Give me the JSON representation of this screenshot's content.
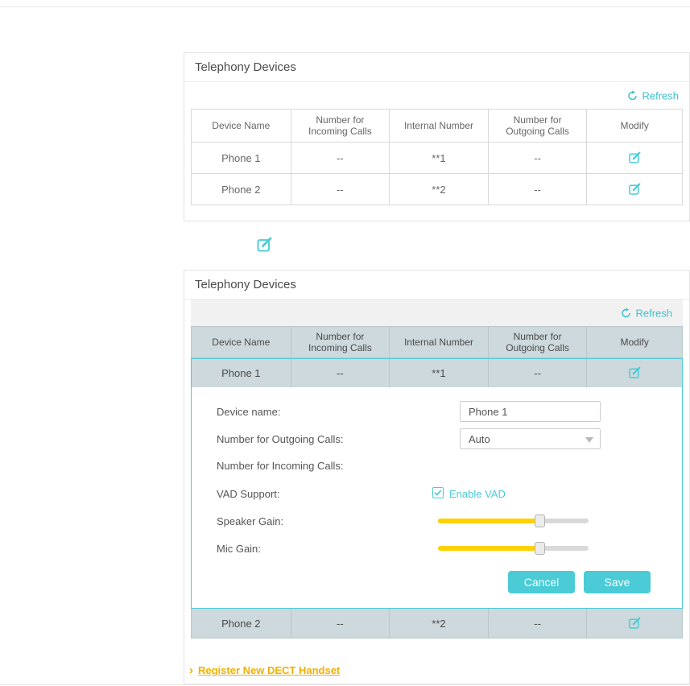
{
  "colors": {
    "accent_teal": "#4acbd6",
    "slider_yellow": "#ffd200",
    "register_link_yellow": "#f2af00"
  },
  "top_panel": {
    "title": "Telephony Devices",
    "refresh_label": "Refresh",
    "headers": [
      "Device Name",
      "Number for Incoming Calls",
      "Internal Number",
      "Number for Outgoing Calls",
      "Modify"
    ],
    "rows": [
      {
        "name": "Phone 1",
        "incoming": "--",
        "internal": "**1",
        "outgoing": "--"
      },
      {
        "name": "Phone 2",
        "incoming": "--",
        "internal": "**2",
        "outgoing": "--"
      }
    ]
  },
  "bottom_panel": {
    "title": "Telephony Devices",
    "refresh_label": "Refresh",
    "headers": [
      "Device Name",
      "Number for Incoming Calls",
      "Internal Number",
      "Number for Outgoing Calls",
      "Modify"
    ],
    "rows": [
      {
        "name": "Phone 1",
        "incoming": "--",
        "internal": "**1",
        "outgoing": "--"
      },
      {
        "name": "Phone 2",
        "incoming": "--",
        "internal": "**2",
        "outgoing": "--"
      }
    ],
    "form": {
      "device_name_label": "Device name:",
      "device_name_value": "Phone 1",
      "outgoing_calls_label": "Number for Outgoing Calls:",
      "outgoing_calls_value": "Auto",
      "incoming_calls_label": "Number for Incoming Calls:",
      "vad_label": "VAD Support:",
      "vad_checkbox_label": "Enable VAD",
      "vad_checked": true,
      "speaker_gain_label": "Speaker Gain:",
      "speaker_gain_percent": 68,
      "mic_gain_label": "Mic Gain:",
      "mic_gain_percent": 68,
      "cancel_label": "Cancel",
      "save_label": "Save"
    },
    "register_link_label": "Register New DECT Handset"
  }
}
